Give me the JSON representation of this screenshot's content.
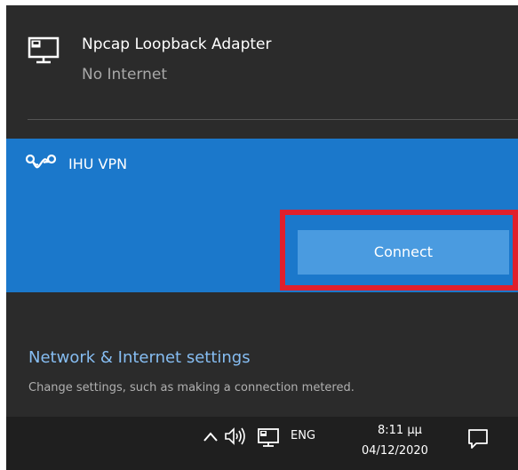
{
  "networks": [
    {
      "name": "Npcap Loopback Adapter",
      "status": "No Internet",
      "icon": "ethernet-monitor-icon"
    }
  ],
  "vpn": {
    "name": "IHU VPN",
    "icon": "vpn-link-icon",
    "connect_label": "Connect",
    "highlight_color": "#e0202c"
  },
  "settings": {
    "link_label": "Network & Internet settings",
    "description": "Change settings, such as making a connection metered."
  },
  "taskbar": {
    "chevron_icon": "chevron-up-icon",
    "speaker_icon": "speaker-icon",
    "network_icon": "ethernet-monitor-icon",
    "language": "ENG",
    "time": "8:11 μμ",
    "date": "04/12/2020",
    "notification_icon": "action-center-icon"
  },
  "colors": {
    "flyout_background": "#2b2b2b",
    "selected_background": "#1b78cb",
    "button_background": "#4a9be0",
    "link": "#86bdf2",
    "taskbar_background": "#1f1f1f"
  }
}
